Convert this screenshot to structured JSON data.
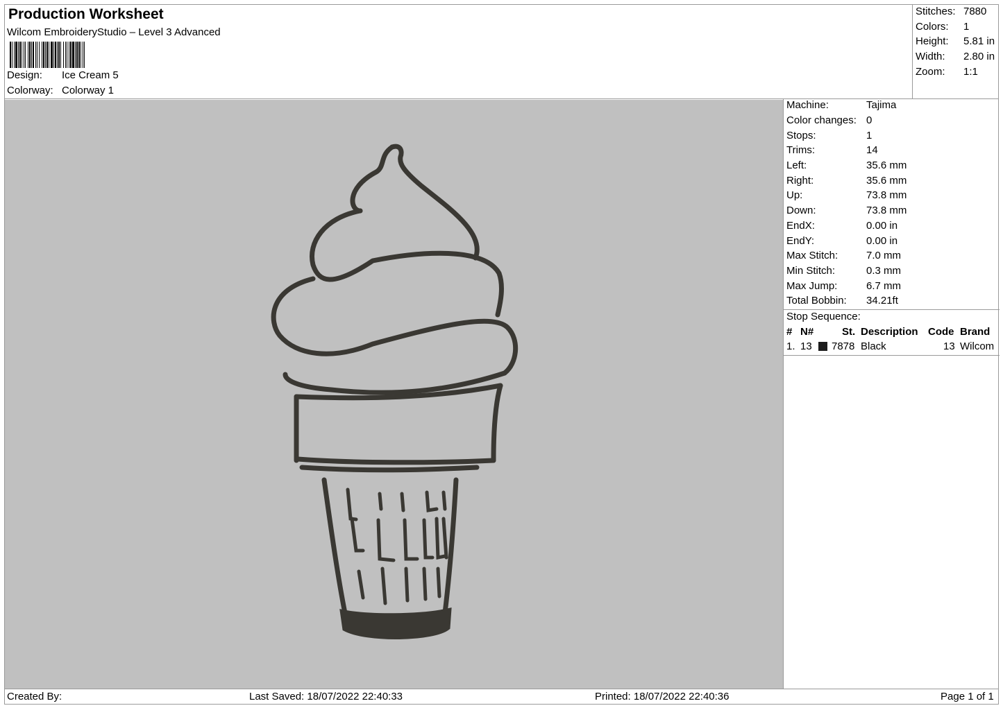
{
  "header": {
    "title": "Production Worksheet",
    "software": "Wilcom EmbroideryStudio – Level 3 Advanced",
    "design_label": "Design:",
    "design_value": "Ice Cream 5",
    "colorway_label": "Colorway:",
    "colorway_value": "Colorway 1"
  },
  "summary": [
    {
      "label": "Stitches:",
      "value": "7880"
    },
    {
      "label": "Colors:",
      "value": "1"
    },
    {
      "label": "Height:",
      "value": "5.81 in"
    },
    {
      "label": "Width:",
      "value": "2.80 in"
    },
    {
      "label": "Zoom:",
      "value": "1:1"
    }
  ],
  "details": [
    {
      "label": "Machine:",
      "value": "Tajima"
    },
    {
      "label": "Color changes:",
      "value": "0"
    },
    {
      "label": "Stops:",
      "value": "1"
    },
    {
      "label": "Trims:",
      "value": "14"
    },
    {
      "label": "Left:",
      "value": "35.6 mm"
    },
    {
      "label": "Right:",
      "value": "35.6 mm"
    },
    {
      "label": "Up:",
      "value": "73.8 mm"
    },
    {
      "label": "Down:",
      "value": "73.8 mm"
    },
    {
      "label": "EndX:",
      "value": "0.00 in"
    },
    {
      "label": "EndY:",
      "value": "0.00 in"
    },
    {
      "label": "Max Stitch:",
      "value": "7.0 mm"
    },
    {
      "label": "Min Stitch:",
      "value": "0.3 mm"
    },
    {
      "label": "Max Jump:",
      "value": "6.7 mm"
    },
    {
      "label": "Total Bobbin:",
      "value": "34.21ft"
    }
  ],
  "stop_sequence": {
    "title": "Stop Sequence:",
    "columns": [
      "#",
      "N#",
      "St.",
      "Description",
      "Code",
      "Brand"
    ],
    "rows": [
      {
        "index": "1.",
        "needle": "13",
        "color": "#1c1c1c",
        "stitches": "7878",
        "description": "Black",
        "code": "13",
        "brand": "Wilcom"
      }
    ]
  },
  "footer": {
    "created_by": "Created By:",
    "last_saved": "Last Saved: 18/07/2022 22:40:33",
    "printed": "Printed: 18/07/2022 22:40:36",
    "page": "Page 1 of 1"
  },
  "colors": {
    "canvas_bg": "#c0c0c0",
    "thread": "#3a3833"
  }
}
